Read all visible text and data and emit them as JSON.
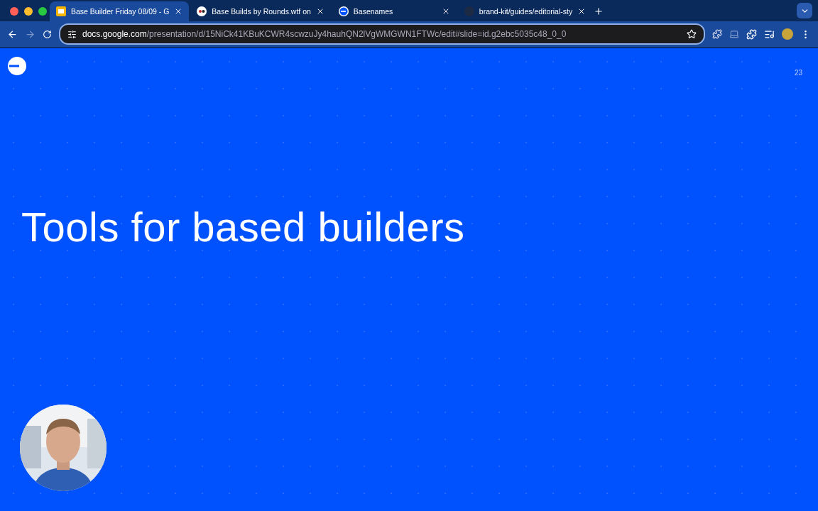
{
  "tabs": [
    {
      "title": "Base Builder Friday 08/09 - G",
      "selected": true,
      "kind": "slides"
    },
    {
      "title": "Base Builds by Rounds.wtf on",
      "selected": false,
      "kind": "rounds"
    },
    {
      "title": "Basenames",
      "selected": false,
      "kind": "base"
    },
    {
      "title": "brand-kit/guides/editorial-sty",
      "selected": false,
      "kind": "github"
    }
  ],
  "address_bar": {
    "host": "docs.google.com",
    "path": "/presentation/d/15NiCk41KBuKCWR4scwzuJy4hauhQN2lVgWMGWN1FTWc/edit#slide=id.g2ebc5035c48_0_0"
  },
  "slide": {
    "number": "23",
    "title": "Tools for based builders"
  }
}
